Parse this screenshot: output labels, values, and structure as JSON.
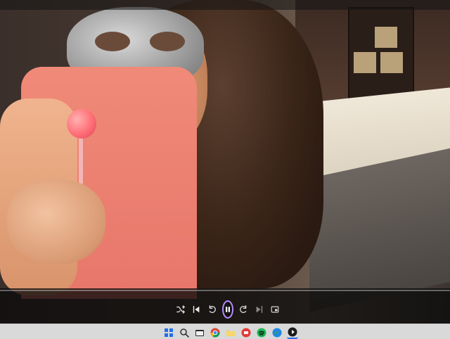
{
  "player": {
    "progress": 0.0,
    "controls": [
      {
        "name": "shuffle",
        "icon": "shuffle-icon"
      },
      {
        "name": "previous",
        "icon": "previous-icon"
      },
      {
        "name": "rewind",
        "icon": "rewind-10-icon"
      },
      {
        "name": "play-pause",
        "icon": "pause-icon",
        "state": "playing"
      },
      {
        "name": "forward",
        "icon": "forward-30-icon"
      },
      {
        "name": "next",
        "icon": "next-icon"
      },
      {
        "name": "miniplayer",
        "icon": "miniplayer-icon"
      }
    ],
    "accent": "#b88cff"
  },
  "taskbar": {
    "icons": [
      "windows-start-icon",
      "search-icon",
      "file-explorer-icon",
      "chrome-icon",
      "folder-icon",
      "app-icon",
      "spotify-icon",
      "edge-icon",
      "media-player-icon"
    ]
  }
}
